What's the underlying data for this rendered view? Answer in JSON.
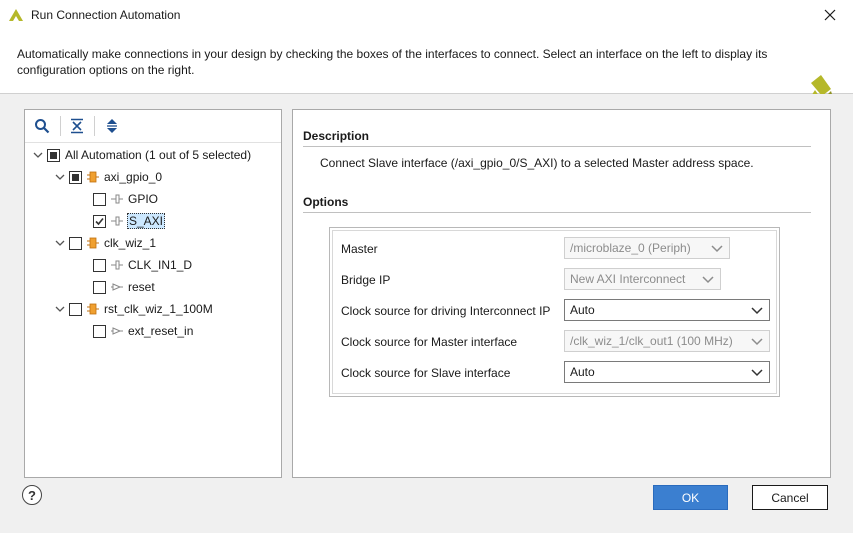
{
  "window": {
    "title": "Run Connection Automation",
    "close_icon": "close-icon"
  },
  "header": {
    "description": "Automatically make connections in your design by checking the boxes of the interfaces to connect. Select an interface on the left to display its configuration options on the right."
  },
  "tree": {
    "root": {
      "label": "All Automation (1 out of 5 selected)",
      "checked": "partial"
    },
    "nodes": [
      {
        "label": "axi_gpio_0",
        "checked": "partial",
        "icon": "ip-block-icon",
        "children": [
          {
            "label": "GPIO",
            "checked": false,
            "icon": "interface-port-icon"
          },
          {
            "label": "S_AXI",
            "checked": true,
            "selected": true,
            "icon": "interface-port-icon"
          }
        ]
      },
      {
        "label": "clk_wiz_1",
        "checked": false,
        "icon": "ip-block-icon",
        "children": [
          {
            "label": "CLK_IN1_D",
            "checked": false,
            "icon": "interface-port-icon"
          },
          {
            "label": "reset",
            "checked": false,
            "icon": "reset-pin-icon"
          }
        ]
      },
      {
        "label": "rst_clk_wiz_1_100M",
        "checked": false,
        "icon": "ip-block-icon",
        "children": [
          {
            "label": "ext_reset_in",
            "checked": false,
            "icon": "reset-pin-icon"
          }
        ]
      }
    ]
  },
  "description_section": {
    "title": "Description",
    "text": "Connect Slave interface (/axi_gpio_0/S_AXI) to a selected Master address space."
  },
  "options_section": {
    "title": "Options",
    "rows": [
      {
        "label": "Master",
        "value": "/microblaze_0 (Periph)",
        "enabled": false
      },
      {
        "label": "Bridge IP",
        "value": "New AXI Interconnect",
        "enabled": false
      },
      {
        "label": "Clock source for driving Interconnect IP",
        "value": "Auto",
        "enabled": true
      },
      {
        "label": "Clock source for Master interface",
        "value": "/clk_wiz_1/clk_out1 (100 MHz)",
        "enabled": false
      },
      {
        "label": "Clock source for Slave interface",
        "value": "Auto",
        "enabled": true
      }
    ]
  },
  "buttons": {
    "help": "?",
    "ok": "OK",
    "cancel": "Cancel"
  },
  "colors": {
    "ok_button": "#3b7fd0",
    "selection": "#cce8ff",
    "logo_green": "#b5b82a"
  }
}
